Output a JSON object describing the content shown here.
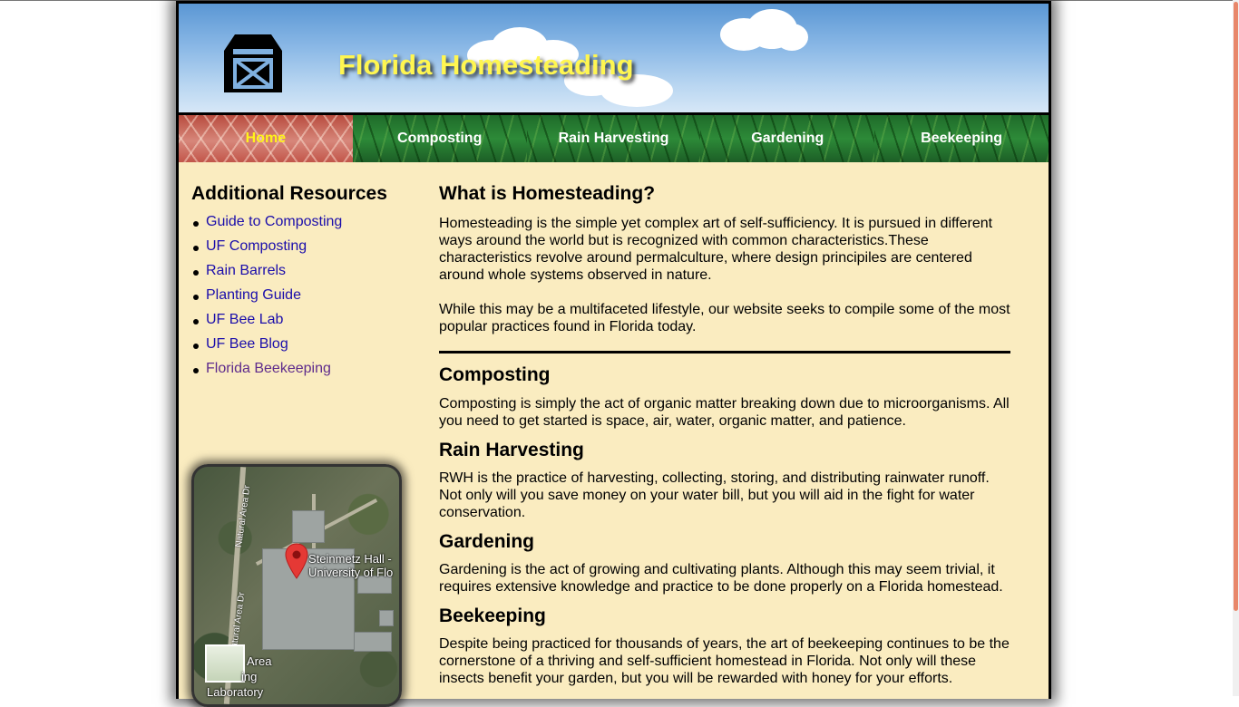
{
  "header": {
    "site_title": "Florida Homesteading",
    "logo_icon": "barn-icon"
  },
  "nav": {
    "items": [
      {
        "label": "Home",
        "active": true
      },
      {
        "label": "Composting",
        "active": false
      },
      {
        "label": "Rain Harvesting",
        "active": false
      },
      {
        "label": "Gardening",
        "active": false
      },
      {
        "label": "Beekeeping",
        "active": false
      }
    ]
  },
  "sidebar": {
    "heading": "Additional Resources",
    "links": [
      {
        "label": "Guide to Composting",
        "visited": false
      },
      {
        "label": "UF Composting",
        "visited": false
      },
      {
        "label": "Rain Barrels",
        "visited": false
      },
      {
        "label": "Planting Guide",
        "visited": false
      },
      {
        "label": "UF Bee Lab",
        "visited": false
      },
      {
        "label": "UF Bee Blog",
        "visited": false
      },
      {
        "label": "Florida Beekeeping",
        "visited": true
      }
    ]
  },
  "map": {
    "place_label_line1": "Steinmetz Hall -",
    "place_label_line2": "University of Flo",
    "road_label_1": "Natural Area Dr",
    "road_label_2": "Natural Area Dr",
    "area_label_line1": "Area",
    "area_label_line2": "ing",
    "area_label_line3": "Laboratory"
  },
  "main": {
    "intro_heading": "What is Homesteading?",
    "intro_p1": "Homesteading is the simple yet complex art of self-sufficiency. It is pursued in different ways around the world but is recognized with common characteristics.These characteristics revolve around permalculture, where design principiles are centered around whole systems observed in nature.",
    "intro_p2": "While this may be a multifaceted lifestyle, our website seeks to compile some of the most popular practices found in Florida today.",
    "sections": [
      {
        "heading": "Composting",
        "text": "Composting is simply the act of organic matter breaking down due to microorganisms. All you need to get started is space, air, water, organic matter, and patience."
      },
      {
        "heading": "Rain Harvesting",
        "text": "RWH is the practice of harvesting, collecting, storing, and distributing rainwater runoff. Not only will you save money on your water bill, but you will aid in the fight for water conservation."
      },
      {
        "heading": "Gardening",
        "text": "Gardening is the act of growing and cultivating plants. Although this may seem trivial, it requires extensive knowledge and practice to be done properly on a Florida homestead."
      },
      {
        "heading": "Beekeeping",
        "text": "Despite being practiced for thousands of years, the art of beekeeping continues to be the cornerstone of a thriving and self-sufficient homestead in Florida. Not only will these insects benefit your garden, but you will be rewarded with honey for your efforts."
      }
    ]
  },
  "colors": {
    "background": "#faecc0",
    "title": "#fff650",
    "link": "#1a0dab",
    "visited_link": "#5e2b8c",
    "active_nav": "#fff31a"
  }
}
